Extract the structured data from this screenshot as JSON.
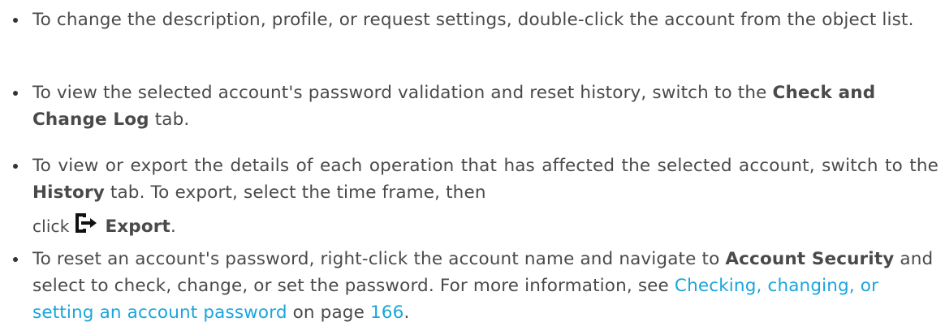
{
  "bullets": {
    "b1": {
      "text": "To change the description, profile, or request settings, double-click the account from the object list."
    },
    "b2": {
      "pre": "To view the selected account's password validation and reset history, switch to the ",
      "bold": "Check and Change Log",
      "post": " tab."
    },
    "b3": {
      "pre": "To view or export the details of each operation that has affected the selected account, switch to the ",
      "bold1": "History",
      "mid": " tab. To export, select the time frame, then",
      "click": "click",
      "icon": "export-icon",
      "bold2": "Export",
      "end": "."
    },
    "b4": {
      "pre": "To reset an account's password, right-click the account name and navigate to ",
      "bold": "Account Security",
      "mid": " and select to check, change, or set the password. For more information, see ",
      "link": "Checking, changing, or setting an account password",
      "mid2": " on page ",
      "page_link": "166",
      "end": "."
    }
  },
  "colors": {
    "text": "#4a4a4a",
    "link": "#1aa5dc"
  }
}
